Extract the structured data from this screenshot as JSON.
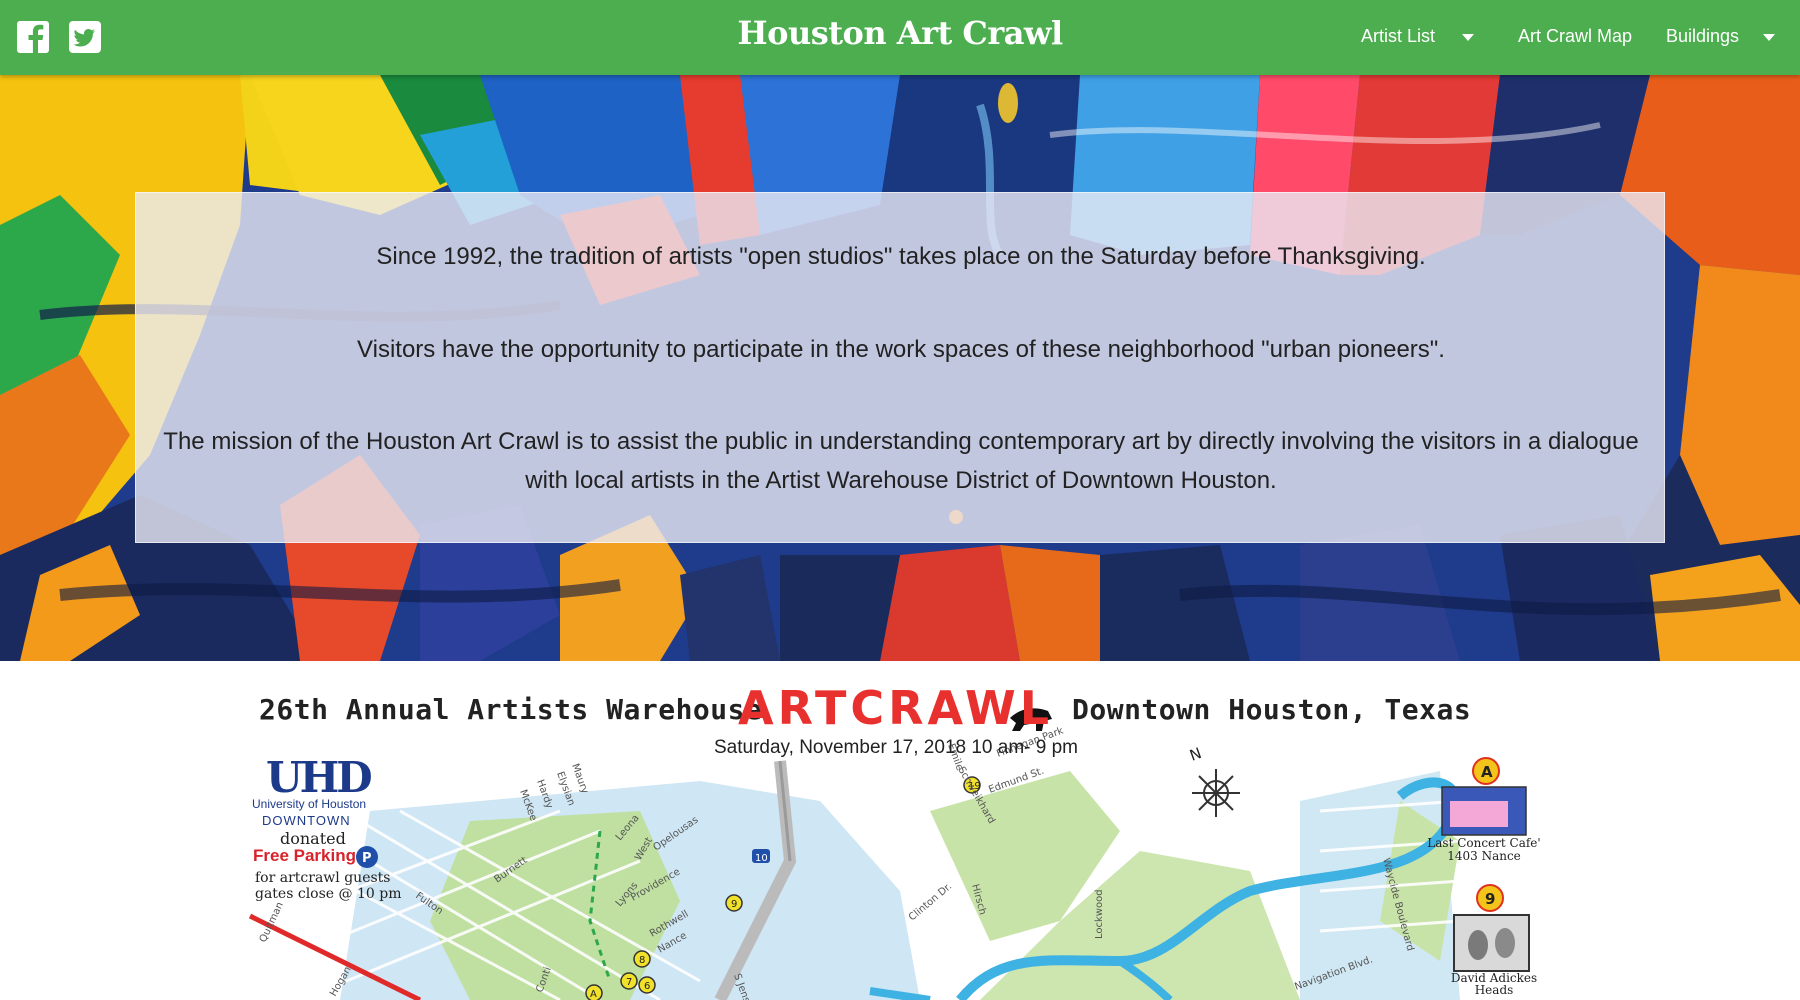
{
  "navbar": {
    "title": "Houston Art Crawl",
    "items": [
      {
        "label": "Artist List",
        "has_dropdown": true
      },
      {
        "label": "Art Crawl Map",
        "has_dropdown": false
      },
      {
        "label": "Buildings",
        "has_dropdown": true
      }
    ],
    "social": [
      "facebook-icon",
      "twitter-icon"
    ],
    "colors": {
      "bar": "#4cae4f",
      "text": "#ffffff"
    }
  },
  "intro": {
    "paragraph_1": "Since 1992, the tradition of artists \"open studios\" takes place on the Saturday before Thanksgiving.",
    "paragraph_2": "Visitors have the opportunity to participate in the work spaces of these neighborhood \"urban pioneers\".",
    "paragraph_3": "The mission of the Houston Art Crawl is to assist the public in understanding contemporary art by directly involving the visitors in a dialogue with local artists in the Artist Warehouse District of Downtown Houston."
  },
  "flyer": {
    "headline_left": "26th Annual Artists Warehouse",
    "headline_brand": "ARTCRAWL",
    "headline_right": "Downtown Houston, Texas",
    "date_line": "Saturday, November 17, 2018 10 am- 9 pm",
    "sponsor": {
      "logo": "UHD",
      "line1": "University of Houston",
      "line2": "DOWNTOWN",
      "line3": "donated",
      "line4": "Free Parking",
      "parking_badge": "P",
      "line5": "for artcrawl guests",
      "line6": "gates close @ 10 pm"
    },
    "compass": "N",
    "highway": "10",
    "locations": [
      {
        "badge": "A",
        "name": "Last Concert Cafe'",
        "address": "1403 Nance"
      },
      {
        "badge": "9",
        "name": "David Adickes",
        "address": "Heads"
      }
    ],
    "street_labels": [
      "Maury",
      "Elysian",
      "Hardy",
      "McKee",
      "Leona",
      "West",
      "Opelousas",
      "Burnett",
      "Fulton",
      "Quitman",
      "Hogan",
      "Lyons",
      "Providence",
      "Rothwell",
      "Nance",
      "Conti",
      "Schweikhard",
      "Finnegan Park",
      "Edmund St.",
      "Clinton Dr.",
      "Hirsch",
      "Lockwood",
      "Waycide Boulevard",
      "Navigation Blvd.",
      "S Jensen",
      "Emile"
    ],
    "markers": [
      "19",
      "9",
      "8",
      "7",
      "6",
      "A"
    ]
  }
}
